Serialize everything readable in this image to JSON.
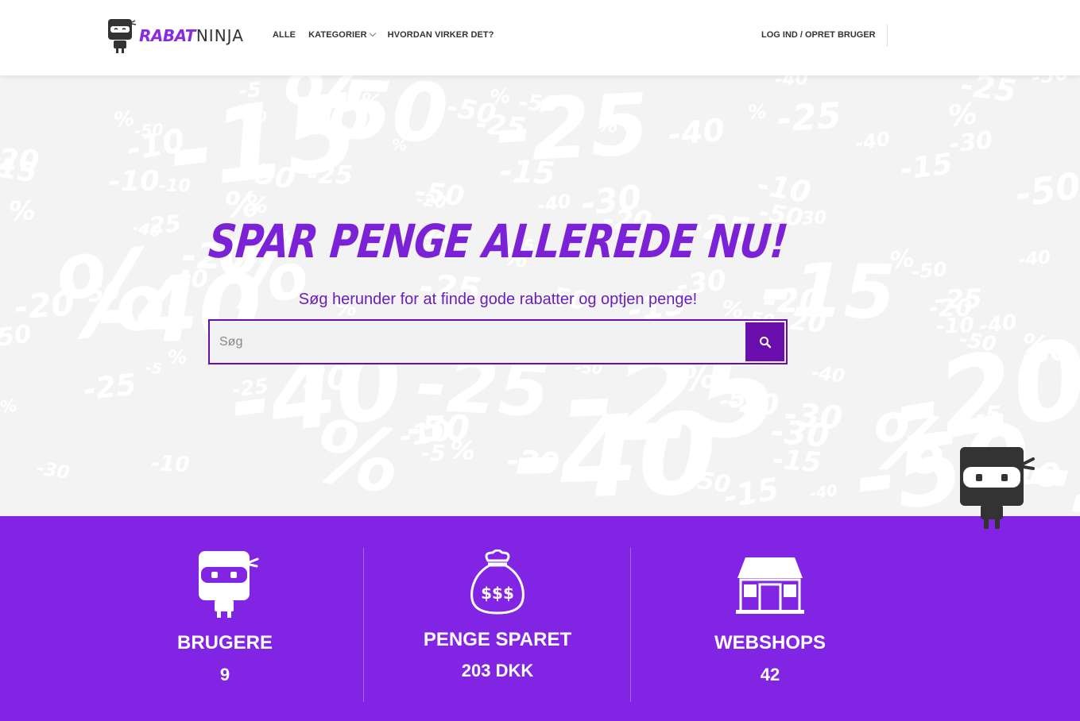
{
  "brand": {
    "name_part1": "RABAT",
    "name_part2": "NINJA"
  },
  "nav": {
    "items": [
      {
        "label": "ALLE"
      },
      {
        "label": "KATEGORIER"
      },
      {
        "label": "HVORDAN VIRKER DET?"
      }
    ],
    "login_label": "LOG IND / OPRET BRUGER"
  },
  "hero": {
    "title": "SPAR PENGE ALLEREDE NU!",
    "subtitle": "Søg herunder for at finde gode rabatter og optjen penge!",
    "search": {
      "placeholder": "Søg",
      "value": ""
    }
  },
  "stats": {
    "users": {
      "label": "BRUGERE",
      "value": "9"
    },
    "saved": {
      "label": "PENGE SPARET",
      "value": "203 DKK"
    },
    "shops": {
      "label": "WEBSHOPS",
      "value": "42"
    }
  },
  "colors": {
    "accent": "#8224e3",
    "accent_dark": "#6a0dad",
    "title": "#7b22d6",
    "hero_bg": "#f3f3f3"
  },
  "icons": {
    "logo": "ninja-logo-icon",
    "search": "search-icon",
    "users": "ninja-icon",
    "saved": "money-bag-icon",
    "shops": "shop-building-icon"
  }
}
